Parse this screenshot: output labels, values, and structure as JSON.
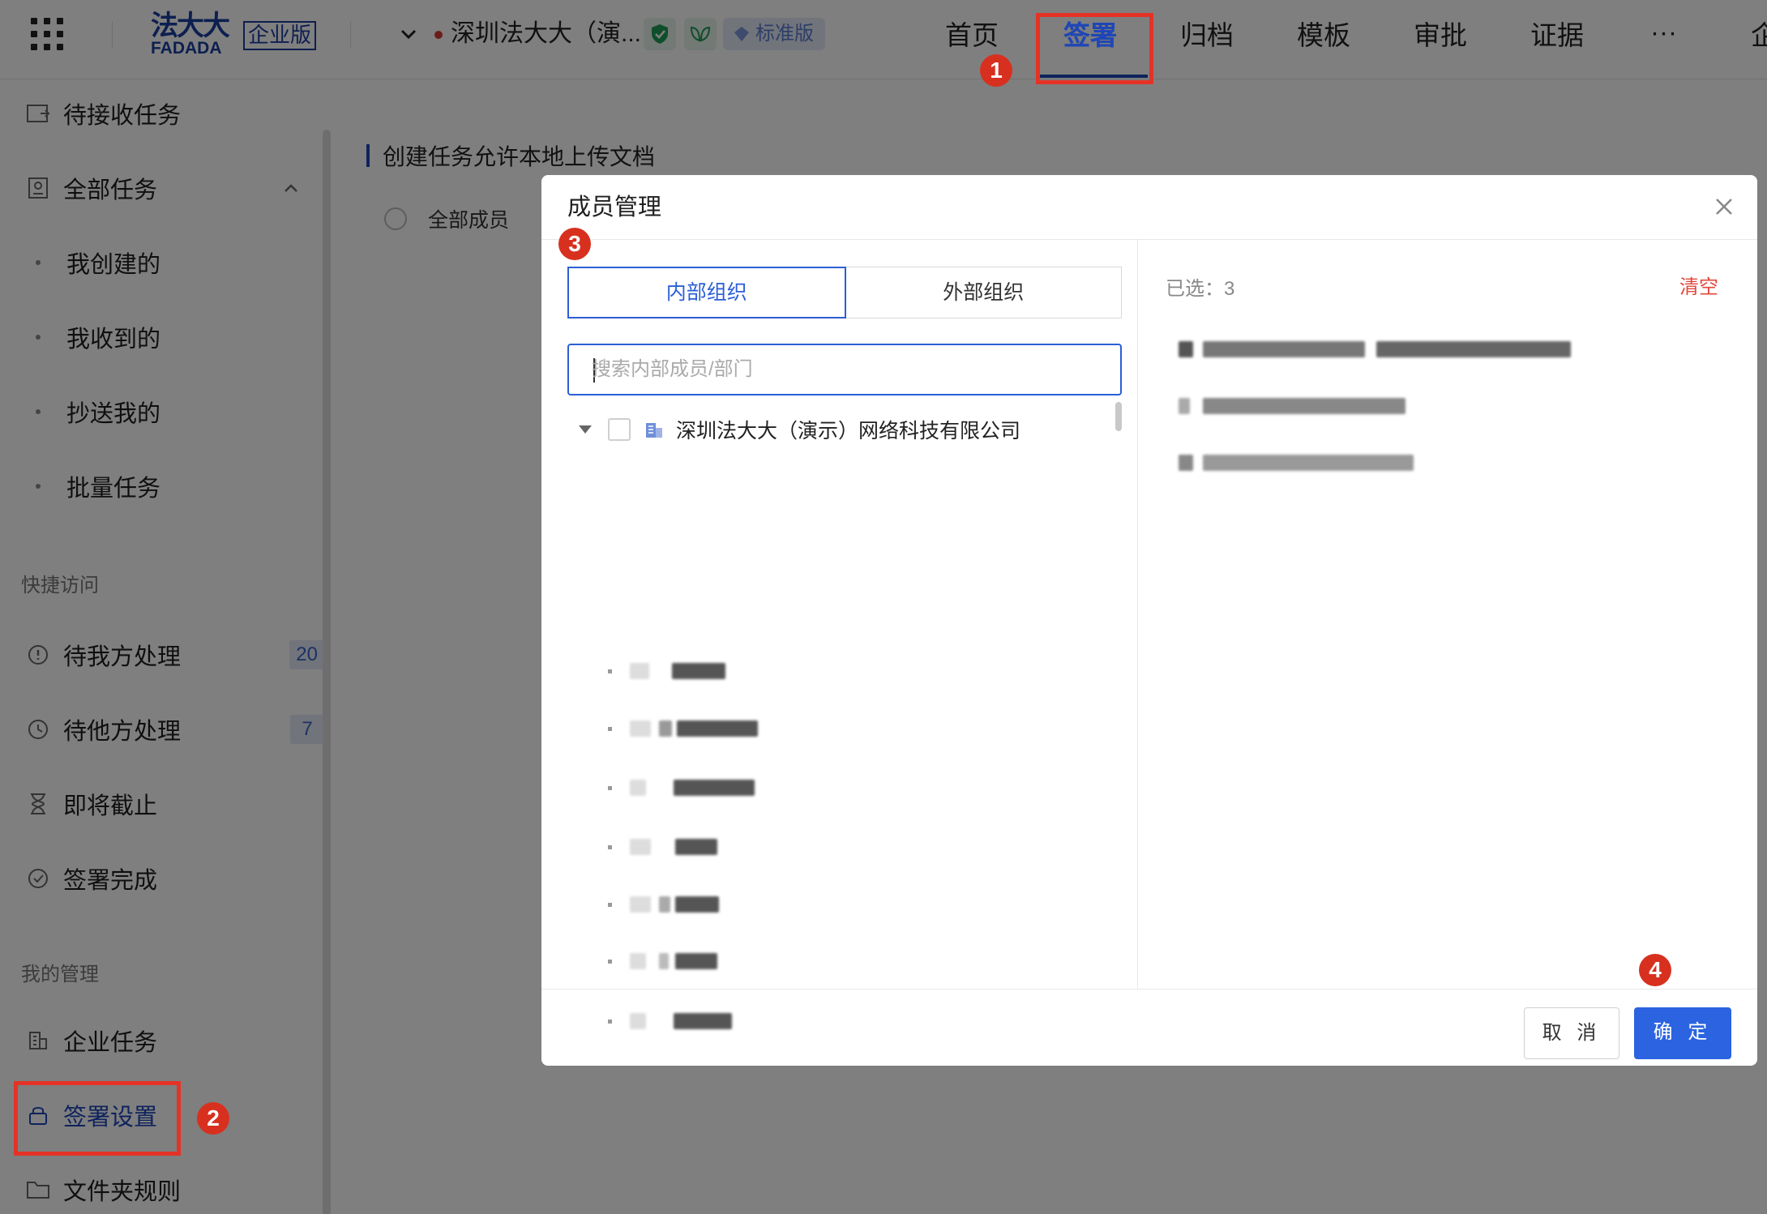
{
  "header": {
    "logo_cn": "法大大",
    "logo_en": "FADADA",
    "edition": "企业版",
    "company": "深圳法大大（演...",
    "plan_badge": "标准版",
    "nav": [
      "首页",
      "签署",
      "归档",
      "模板",
      "审批",
      "证据"
    ],
    "more": "···",
    "overflow_char": "企"
  },
  "sidebar": {
    "pending_receive": "待接收任务",
    "all_tasks": "全部任务",
    "sub_items": [
      "我创建的",
      "我收到的",
      "抄送我的",
      "批量任务"
    ],
    "quick_access_title": "快捷访问",
    "quick": [
      {
        "label": "待我方处理",
        "count": "20"
      },
      {
        "label": "待他方处理",
        "count": "7"
      },
      {
        "label": "即将截止",
        "count": ""
      },
      {
        "label": "签署完成",
        "count": ""
      }
    ],
    "manage_title": "我的管理",
    "manage": [
      "企业任务",
      "签署设置",
      "文件夹规则"
    ]
  },
  "main": {
    "section_title": "创建任务允许本地上传文档",
    "radio_label": "全部成员"
  },
  "dialog": {
    "title": "成员管理",
    "tabs": [
      "内部组织",
      "外部组织"
    ],
    "search_placeholder": "搜索内部成员/部门",
    "root_org": "深圳法大大（演示）网络科技有限公司",
    "selected_label": "已选：3",
    "clear_label": "清空",
    "cancel_label": "取 消",
    "ok_label": "确 定"
  },
  "annotations": [
    "1",
    "2",
    "3",
    "4"
  ],
  "colors": {
    "brand": "#1f47b8",
    "primary_button": "#2b63e0",
    "annotation_red": "#e43326",
    "clear_red": "#e2473b"
  }
}
